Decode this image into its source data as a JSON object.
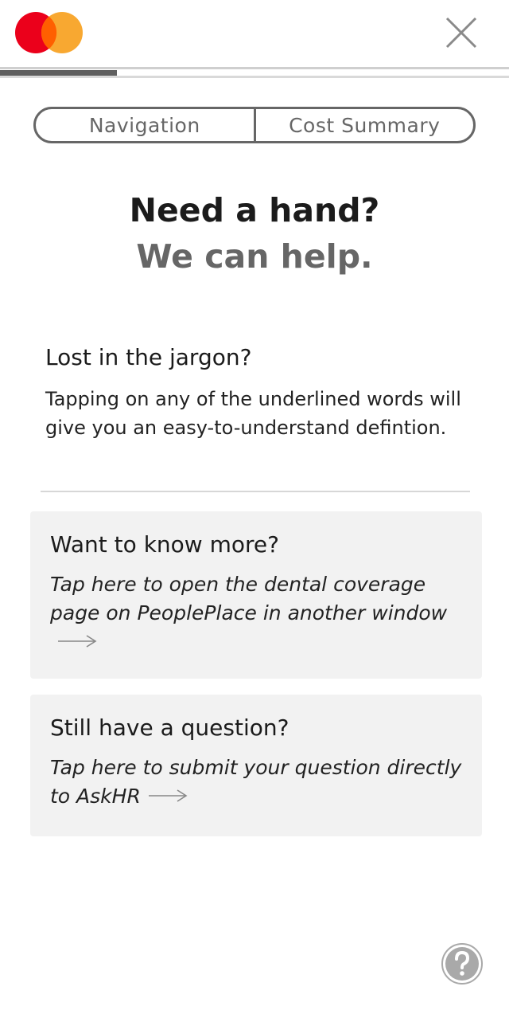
{
  "header": {
    "logo_icon": "mastercard-logo-icon",
    "close_icon": "close-icon",
    "progress_fraction": 0.23
  },
  "tabs": [
    {
      "label": "Navigation"
    },
    {
      "label": "Cost Summary"
    }
  ],
  "headline": {
    "line1": "Need a hand?",
    "line2": "We can help."
  },
  "jargon": {
    "title": "Lost in the jargon?",
    "body": "Tapping on any of the underlined words will give you an easy-to-understand defintion."
  },
  "cards": [
    {
      "title": "Want to know more?",
      "body": "Tap here to open the dental coverage page on PeoplePlace in another window",
      "icon": "arrow-right-icon"
    },
    {
      "title": "Still have a question?",
      "body": "Tap here to submit your question directly to AskHR",
      "icon": "arrow-right-icon"
    }
  ],
  "help_icon": "question-mark-icon",
  "colors": {
    "logo_red": "#eb001b",
    "logo_orange": "#f79e1b",
    "card_bg": "#f2f2f2",
    "accent_gray": "#666666"
  }
}
